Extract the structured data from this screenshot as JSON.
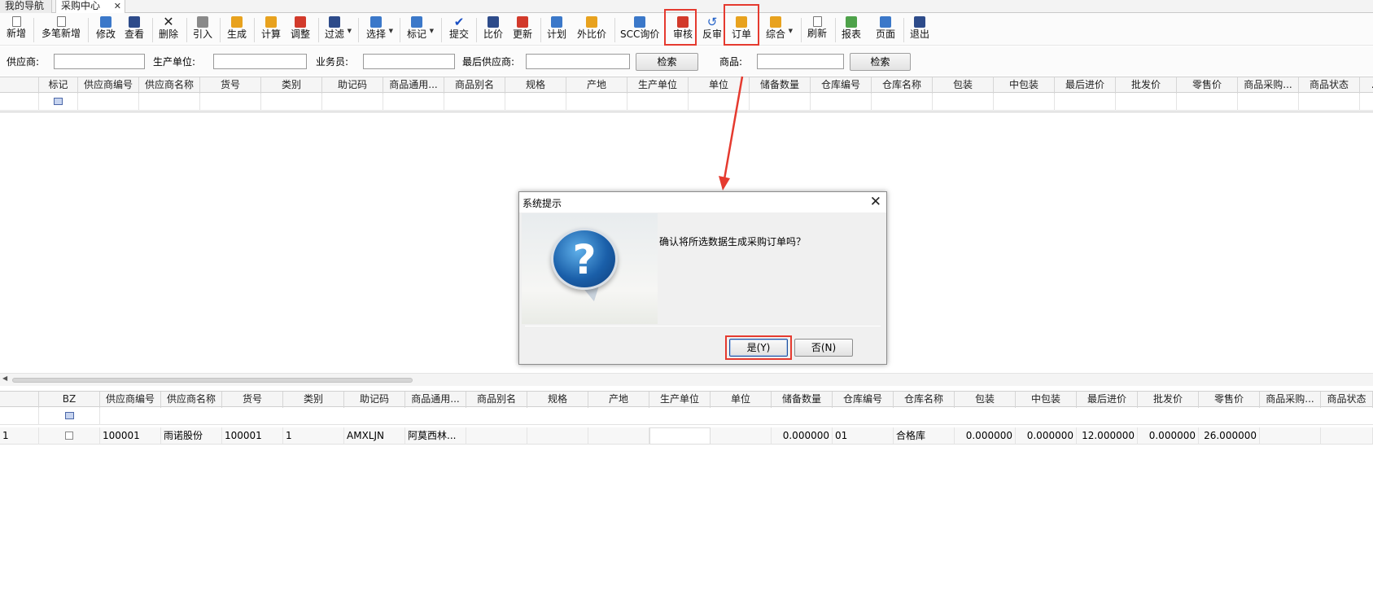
{
  "tabs": [
    {
      "label": "我的导航"
    },
    {
      "label": "采购中心",
      "close": "✕"
    }
  ],
  "toolbar": {
    "items": [
      {
        "label": "新增",
        "icon": "new-doc-icon"
      },
      {
        "label": "多笔新增",
        "icon": "multi-new-icon"
      },
      {
        "label": "修改",
        "icon": "edit-icon"
      },
      {
        "label": "查看",
        "icon": "view-icon"
      },
      {
        "label": "删除",
        "icon": "delete-icon"
      },
      {
        "label": "引入",
        "icon": "import-icon"
      },
      {
        "label": "生成",
        "icon": "generate-icon"
      },
      {
        "label": "计算",
        "icon": "calculate-icon"
      },
      {
        "label": "调整",
        "icon": "adjust-icon"
      },
      {
        "label": "过滤",
        "icon": "filter-icon"
      },
      {
        "label": "选择",
        "icon": "select-icon"
      },
      {
        "label": "标记",
        "icon": "mark-icon"
      },
      {
        "label": "提交",
        "icon": "submit-check-icon"
      },
      {
        "label": "比价",
        "icon": "compare-price-icon"
      },
      {
        "label": "更新",
        "icon": "update-icon"
      },
      {
        "label": "计划",
        "icon": "plan-icon"
      },
      {
        "label": "外比价",
        "icon": "external-compare-icon"
      },
      {
        "label": "SCC询价",
        "icon": "scc-inquiry-icon"
      },
      {
        "label": "审核",
        "icon": "audit-icon"
      },
      {
        "label": "反审",
        "icon": "unaudit-icon"
      },
      {
        "label": "订单",
        "icon": "order-icon"
      },
      {
        "label": "综合",
        "icon": "composite-icon"
      },
      {
        "label": "刷新",
        "icon": "refresh-icon"
      },
      {
        "label": "报表",
        "icon": "report-icon"
      },
      {
        "label": "页面",
        "icon": "page-icon"
      },
      {
        "label": "退出",
        "icon": "exit-icon"
      }
    ]
  },
  "filter": {
    "supplier_label": "供应商:",
    "producer_label": "生产单位:",
    "salesman_label": "业务员:",
    "last_supplier_label": "最后供应商:",
    "search1_label": "检索",
    "goods_label": "商品:",
    "search2_label": "检索",
    "supplier_value": "",
    "producer_value": "",
    "salesman_value": "",
    "last_supplier_value": "",
    "goods_value": ""
  },
  "upper_grid": {
    "columns": [
      "标记",
      "供应商编号",
      "供应商名称",
      "货号",
      "类别",
      "助记码",
      "商品通用...",
      "商品别名",
      "规格",
      "产地",
      "生产单位",
      "单位",
      "储备数量",
      "仓库编号",
      "仓库名称",
      "包装",
      "中包装",
      "最后进价",
      "批发价",
      "零售价",
      "商品采购...",
      "商品状态",
      "..."
    ]
  },
  "lower_grid": {
    "columns": [
      "",
      "BZ",
      "供应商编号",
      "供应商名称",
      "货号",
      "类别",
      "助记码",
      "商品通用...",
      "商品别名",
      "规格",
      "产地",
      "生产单位",
      "单位",
      "储备数量",
      "仓库编号",
      "仓库名称",
      "包装",
      "中包装",
      "最后进价",
      "批发价",
      "零售价",
      "商品采购...",
      "商品状态"
    ],
    "rows": [
      {
        "rownum": "1",
        "supplier_code": "100001",
        "supplier_name": "雨诺股份",
        "item_no": "100001",
        "category": "1",
        "mnemonic": "AMXLJN",
        "generic_name": "阿莫西林...",
        "alias": "",
        "spec": "",
        "origin": "",
        "producer": "",
        "unit": "",
        "reserve_qty": "0.000000",
        "warehouse_code": "01",
        "warehouse_name": "合格库",
        "package": "0.000000",
        "mid_package": "0.000000",
        "last_price": "12.000000",
        "wholesale": "0.000000",
        "retail": "26.000000",
        "purchase": "",
        "status": ""
      }
    ]
  },
  "dialog": {
    "title": "系统提示",
    "message": "确认将所选数据生成采购订单吗？",
    "yes_label": "是(Y)",
    "no_label": "否(N)",
    "close": "✕"
  },
  "colors": {
    "highlight": "#e53a2f",
    "dialog_bg": "#f0f0f0"
  }
}
